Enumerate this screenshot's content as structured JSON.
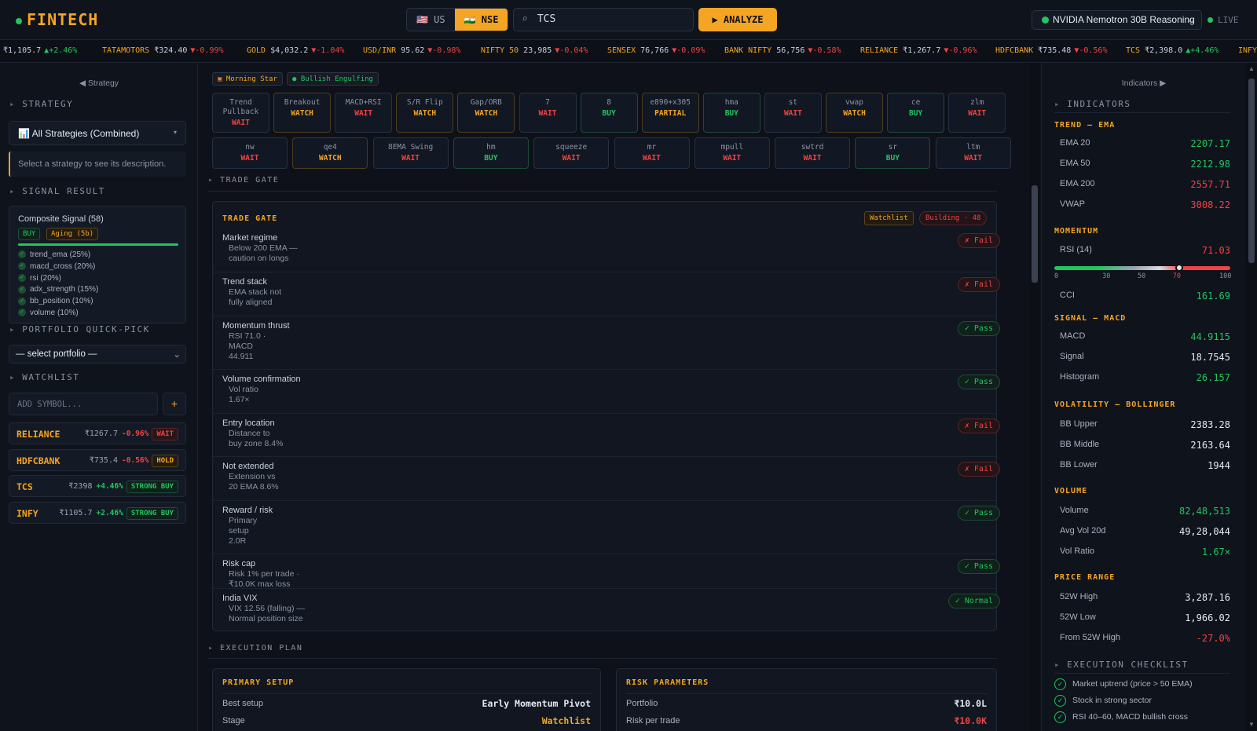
{
  "brand": {
    "name": "FINTECH"
  },
  "markets": [
    "🇺🇸 US",
    "🇮🇳 NSE"
  ],
  "search": {
    "value": "TCS",
    "icon": "search-icon"
  },
  "analyze_label": "▶ ANALYZE",
  "model": {
    "selected": "NVIDIA Nemotron 30B Reasoning"
  },
  "live_label": "LIVE",
  "ticker": [
    {
      "sym": "",
      "price": "₹1,105.7",
      "chg": "▲+2.46%",
      "up": true
    },
    {
      "sym": "TATAMOTORS",
      "price": "₹324.40",
      "chg": "▼-0.99%",
      "up": false
    },
    {
      "sym": "GOLD",
      "price": "$4,032.2",
      "chg": "▼-1.04%",
      "up": false
    },
    {
      "sym": "USD/INR",
      "price": "95.62",
      "chg": "▼-0.98%",
      "up": false
    },
    {
      "sym": "NIFTY 50",
      "price": "23,985",
      "chg": "▼-0.04%",
      "up": false
    },
    {
      "sym": "SENSEX",
      "price": "76,766",
      "chg": "▼-0.09%",
      "up": false
    },
    {
      "sym": "BANK NIFTY",
      "price": "56,756",
      "chg": "▼-0.58%",
      "up": false
    },
    {
      "sym": "RELIANCE",
      "price": "₹1,267.7",
      "chg": "▼-0.96%",
      "up": false
    },
    {
      "sym": "HDFCBANK",
      "price": "₹735.48",
      "chg": "▼-0.56%",
      "up": false
    },
    {
      "sym": "TCS",
      "price": "₹2,398.0",
      "chg": "▲+4.46%",
      "up": true
    },
    {
      "sym": "INFY",
      "price": "",
      "chg": "",
      "up": true
    }
  ],
  "left": {
    "toggle": "◀ Strategy",
    "strategy_head": "STRATEGY",
    "strategy_select": "📊 All Strategies (Combined)",
    "strategy_desc": "Select a strategy to see its description.",
    "signal_head": "SIGNAL RESULT",
    "composite_title": "Composite Signal (58)",
    "composite_badge": "BUY",
    "composite_age": "Aging (5b)",
    "factors": [
      "trend_ema (25%)",
      "macd_cross (20%)",
      "rsi (20%)",
      "adx_strength (15%)",
      "bb_position (10%)",
      "volume (10%)"
    ],
    "portfolio_head": "PORTFOLIO QUICK-PICK",
    "portfolio_select": "— select portfolio —",
    "watch_head": "WATCHLIST",
    "add_placeholder": "ADD SYMBOL...",
    "add_btn": "+",
    "watchlist": [
      {
        "sym": "RELIANCE",
        "price": "₹1267.7",
        "chg": "-0.96%",
        "tag": "WAIT",
        "up": false,
        "kind": "wait"
      },
      {
        "sym": "HDFCBANK",
        "price": "₹735.4",
        "chg": "-0.56%",
        "tag": "HOLD",
        "up": false,
        "kind": "hold"
      },
      {
        "sym": "TCS",
        "price": "₹2398",
        "chg": "+4.46%",
        "tag": "STRONG BUY",
        "up": true,
        "kind": "buy"
      },
      {
        "sym": "INFY",
        "price": "₹1105.7",
        "chg": "+2.46%",
        "tag": "STRONG BUY",
        "up": true,
        "kind": "buy"
      }
    ]
  },
  "patterns": [
    "Morning Star",
    "Bullish Engulfing"
  ],
  "strategy_row1": [
    {
      "n": "Trend Pullback",
      "s": "WAIT"
    },
    {
      "n": "Breakout",
      "s": "WATCH"
    },
    {
      "n": "MACD+RSI",
      "s": "WAIT"
    },
    {
      "n": "S/R Flip",
      "s": "WATCH"
    },
    {
      "n": "Gap/ORB",
      "s": "WATCH"
    },
    {
      "n": "7",
      "s": "WAIT"
    },
    {
      "n": "8",
      "s": "BUY"
    },
    {
      "n": "e890+x305",
      "s": "PARTIAL"
    },
    {
      "n": "hma",
      "s": "BUY"
    },
    {
      "n": "st",
      "s": "WAIT"
    },
    {
      "n": "vwap",
      "s": "WATCH"
    },
    {
      "n": "ce",
      "s": "BUY"
    },
    {
      "n": "zlm",
      "s": "WAIT"
    }
  ],
  "strategy_row2": [
    {
      "n": "nw",
      "s": "WAIT"
    },
    {
      "n": "qe4",
      "s": "WATCH"
    },
    {
      "n": "8EMA Swing",
      "s": "WAIT"
    },
    {
      "n": "hm",
      "s": "BUY"
    },
    {
      "n": "squeeze",
      "s": "WAIT"
    },
    {
      "n": "mr",
      "s": "WAIT"
    },
    {
      "n": "mpull",
      "s": "WAIT"
    },
    {
      "n": "swtrd",
      "s": "WAIT"
    },
    {
      "n": "sr",
      "s": "BUY"
    },
    {
      "n": "ltm",
      "s": "WAIT"
    }
  ],
  "trade_gate": {
    "section": "TRADE GATE",
    "title": "TRADE GATE",
    "badge1": "Watchlist",
    "badge2": "Building · 48",
    "rows": [
      {
        "t": "Market regime",
        "d": [
          "Below 200 EMA —",
          "caution on longs"
        ],
        "b": "✗ Fail",
        "k": "fail"
      },
      {
        "t": "Trend stack",
        "d": [
          "EMA stack not",
          "fully aligned"
        ],
        "b": "✗ Fail",
        "k": "fail"
      },
      {
        "t": "Momentum thrust",
        "d": [
          "RSI 71.0 ·",
          "MACD",
          "44.911"
        ],
        "b": "✓ Pass",
        "k": "pass"
      },
      {
        "t": "Volume confirmation",
        "d": [
          "Vol ratio",
          "1.67×"
        ],
        "b": "✓ Pass",
        "k": "pass"
      },
      {
        "t": "Entry location",
        "d": [
          "Distance to",
          "buy zone 8.4%"
        ],
        "b": "✗ Fail",
        "k": "fail"
      },
      {
        "t": "Not extended",
        "d": [
          "Extension vs",
          "20 EMA 8.6%"
        ],
        "b": "✗ Fail",
        "k": "fail"
      },
      {
        "t": "Reward / risk",
        "d": [
          "Primary",
          "setup",
          "2.0R"
        ],
        "b": "✓ Pass",
        "k": "pass"
      },
      {
        "t": "Risk cap",
        "d": [
          "Risk 1% per trade ·",
          "₹10.0K max loss"
        ],
        "b": "✓ Pass",
        "k": "pass"
      },
      {
        "t": "India VIX",
        "d": [
          "VIX 12.56 (falling) —",
          "Normal position size"
        ],
        "b": "✓ Normal",
        "k": "pass"
      }
    ]
  },
  "execution": {
    "section": "EXECUTION PLAN",
    "primary_title": "PRIMARY SETUP",
    "best_label": "Best setup",
    "best_value": "Early Momentum Pivot",
    "stage_label": "Stage",
    "stage_value": "Watchlist",
    "risk_title": "RISK PARAMETERS",
    "portfolio_label": "Portfolio",
    "portfolio_value": "₹10.0L",
    "rpt_label": "Risk per trade",
    "rpt_value": "₹10.0K"
  },
  "right": {
    "toggle": "Indicators ▶",
    "head": "INDICATORS",
    "trend_head": "TREND — EMA",
    "ema20": "2207.17",
    "ema50": "2212.98",
    "ema200": "2557.71",
    "vwap": "3008.22",
    "momentum_head": "MOMENTUM",
    "rsi": "71.03",
    "rsi_value": 71.03,
    "rsi_ticks": [
      "0",
      "30",
      "50",
      "70",
      "100"
    ],
    "cci": "161.69",
    "macd_head": "SIGNAL — MACD",
    "macd": "44.9115",
    "signal": "18.7545",
    "hist": "26.157",
    "boll_head": "VOLATILITY — BOLLINGER",
    "bbu": "2383.28",
    "bbm": "2163.64",
    "bbl": "1944",
    "vol_head": "VOLUME",
    "volume": "82,48,513",
    "avgvol": "49,28,044",
    "volratio": "1.67×",
    "range_head": "PRICE RANGE",
    "hi52": "3,287.16",
    "lo52": "1,966.02",
    "from52": "-27.0%",
    "check_head": "EXECUTION CHECKLIST",
    "checks": [
      "Market uptrend (price > 50 EMA)",
      "Stock in strong sector",
      "RSI 40–60, MACD bullish cross"
    ]
  },
  "labels": {
    "ema20": "EMA 20",
    "ema50": "EMA 50",
    "ema200": "EMA 200",
    "vwap": "VWAP",
    "rsi": "RSI (14)",
    "cci": "CCI",
    "macd": "MACD",
    "signal": "Signal",
    "hist": "Histogram",
    "bbu": "BB Upper",
    "bbm": "BB Middle",
    "bbl": "BB Lower",
    "volume": "Volume",
    "avgvol": "Avg Vol 20d",
    "volratio": "Vol Ratio",
    "hi52": "52W High",
    "lo52": "52W Low",
    "from52": "From 52W High"
  }
}
